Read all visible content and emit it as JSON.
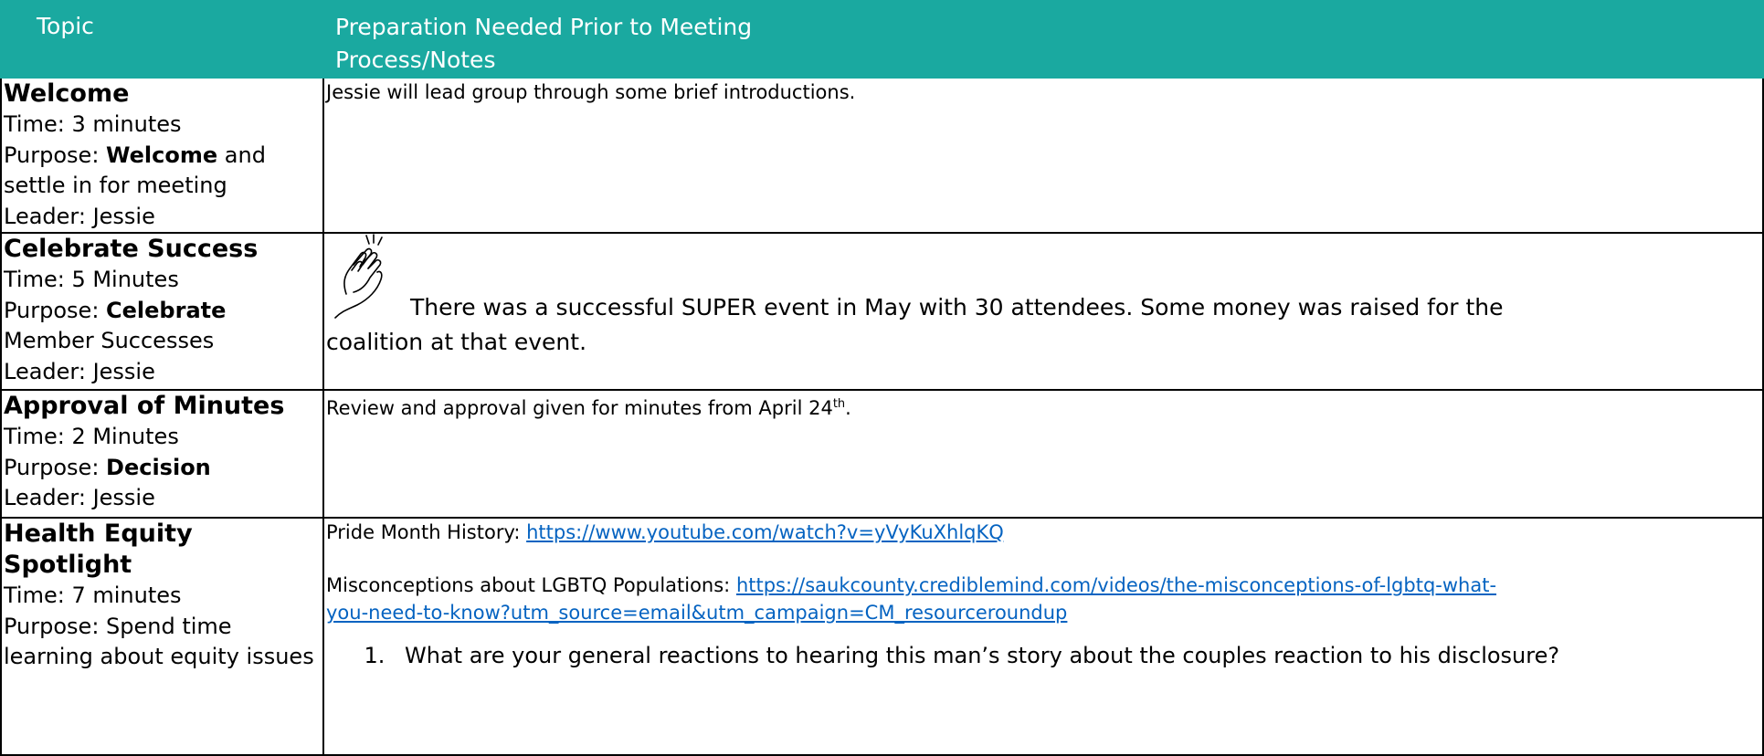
{
  "header": {
    "topic": "Topic",
    "prep_line1": "Preparation Needed Prior to Meeting",
    "prep_line2": "Process/Notes"
  },
  "rows": [
    {
      "title": "Welcome",
      "time": "Time: 3 minutes",
      "purpose_prefix": "Purpose: ",
      "purpose_bold": "Welcome",
      "purpose_rest": " and settle in for meeting",
      "leader": "Leader: Jessie",
      "notes": "Jessie will lead group through some brief introductions."
    },
    {
      "title": "Celebrate Success",
      "time": "Time: 5 Minutes",
      "purpose_prefix": "Purpose: ",
      "purpose_bold": "Celebrate",
      "purpose_rest": " Member Successes",
      "leader": "Leader: Jessie",
      "icon": "clapping-hands-icon",
      "notes_line1": "There was a successful SUPER event in May with 30 attendees.  Some money was raised for the",
      "notes_line2": "coalition at that event."
    },
    {
      "title": "Approval of Minutes",
      "time": "Time: 2 Minutes",
      "purpose_prefix": "Purpose: ",
      "purpose_bold": "Decision",
      "leader": "Leader: Jessie",
      "notes_text": "Review and approval given for minutes from April 24",
      "notes_sup": "th",
      "notes_end": "."
    },
    {
      "title": "Health Equity Spotlight",
      "time": "Time: 7 minutes",
      "purpose": "Purpose: Spend time learning about equity issues",
      "pride_label": "Pride Month History: ",
      "pride_url": "https://www.youtube.com/watch?v=yVyKuXhlqKQ",
      "misconceptions_label": "Misconceptions about LGBTQ Populations: ",
      "misconceptions_url_line1": "https://saukcounty.crediblemind.com/videos/the-misconceptions-of-lgbtq-what-",
      "misconceptions_url_line2": "you-need-to-know?utm_source=email&utm_campaign=CM_resourceroundup",
      "questions": [
        "What are your general reactions to hearing this man’s story about the couples reaction to his disclosure?"
      ]
    }
  ],
  "colors": {
    "header_bg": "#1aa9a0",
    "link": "#0563c1"
  }
}
